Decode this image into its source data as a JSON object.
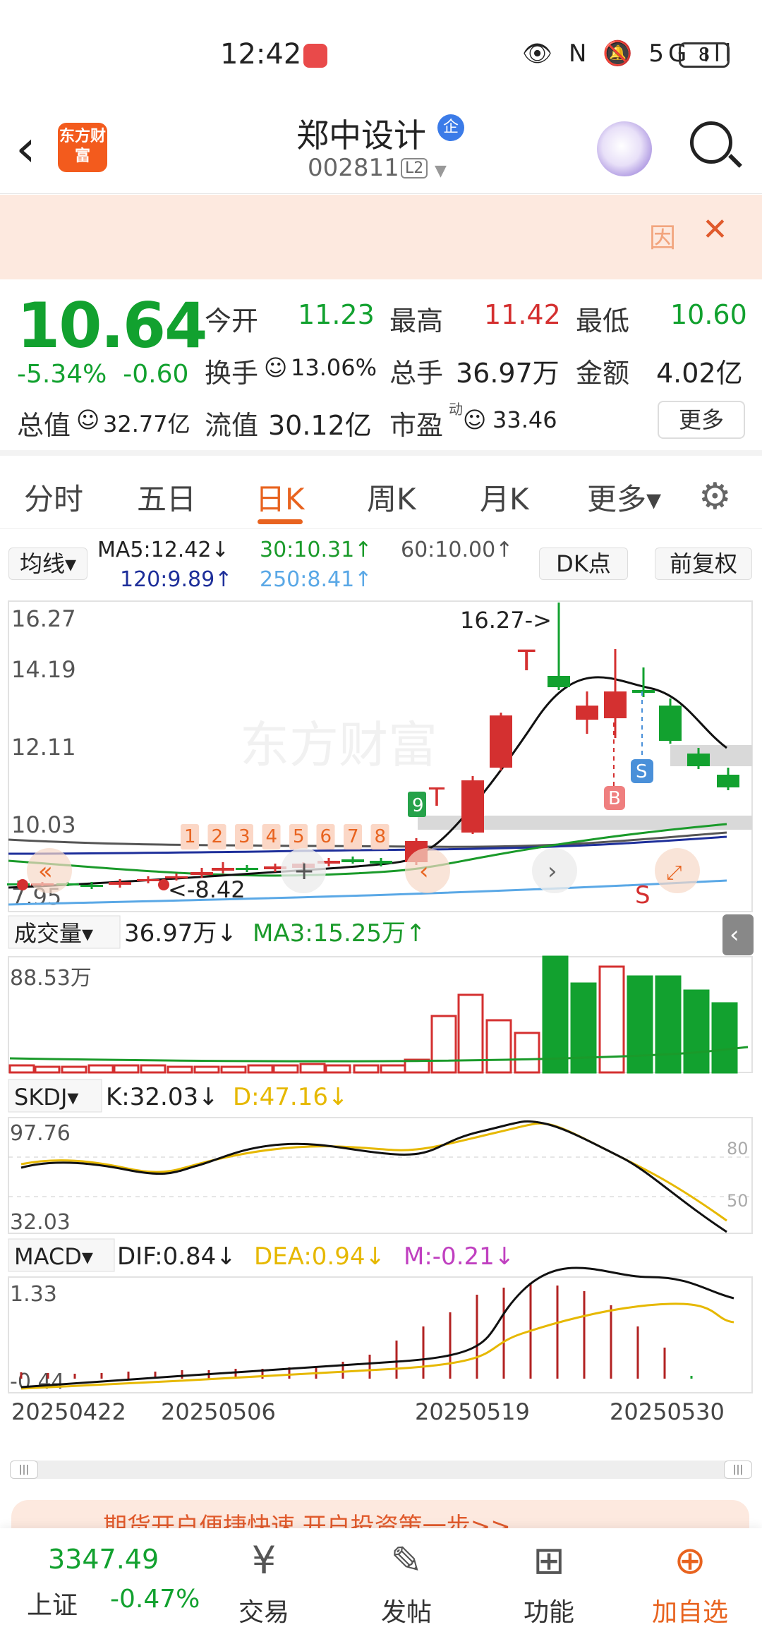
{
  "status": {
    "time": "12:42",
    "icons": "👁 N 🔕 5G ıll",
    "battery": "8"
  },
  "header": {
    "logo_text": "东方财富",
    "title": "郑中设计",
    "badge": "企",
    "code": "002811",
    "level": "L2"
  },
  "banner": {
    "text": "因",
    "close": "✕"
  },
  "quote": {
    "price": "10.64",
    "change_pct": "-5.34%",
    "change": "-0.60",
    "open_label": "今开",
    "open": "11.23",
    "high_label": "最高",
    "high": "11.42",
    "low_label": "最低",
    "low": "10.60",
    "turnover_label": "换手",
    "turnover": "13.06%",
    "volume_label": "总手",
    "volume": "36.97万",
    "amount_label": "金额",
    "amount": "4.02亿",
    "mktcap_label": "总值",
    "mktcap": "32.77亿",
    "float_label": "流值",
    "float": "30.12亿",
    "pe_label": "市盈",
    "pe_sup": "动",
    "pe": "33.46",
    "more": "更多"
  },
  "tabs": [
    {
      "label": "分时"
    },
    {
      "label": "五日"
    },
    {
      "label": "日K"
    },
    {
      "label": "周K"
    },
    {
      "label": "月K"
    },
    {
      "label": "更多▾"
    }
  ],
  "ma": {
    "selector": "均线▾",
    "ma5": "MA5:12.42↓",
    "ma30": "30:10.31↑",
    "ma60": "60:10.00↑",
    "ma120": "120:9.89↑",
    "ma250": "250:8.41↑",
    "dk": "DK点",
    "fq": "前复权"
  },
  "kchart": {
    "y_labels": [
      "16.27",
      "14.19",
      "12.11",
      "10.03",
      "7.95"
    ],
    "peak_label": "16.27->",
    "low_label": "<-8.42",
    "counts": [
      "1",
      "2",
      "3",
      "4",
      "5",
      "6",
      "7",
      "8"
    ],
    "nine": "9",
    "watermark": "东方财富"
  },
  "volume": {
    "selector": "成交量▾",
    "value": "36.97万↓",
    "ma3": "MA3:15.25万↑",
    "max_label": "88.53万"
  },
  "skdj": {
    "selector": "SKDJ▾",
    "k": "K:32.03↓",
    "d": "D:47.16↓",
    "top": "97.76",
    "bottom": "32.03",
    "l80": "80",
    "l50": "50"
  },
  "macd": {
    "selector": "MACD▾",
    "dif": "DIF:0.84↓",
    "dea": "DEA:0.94↓",
    "m": "M:-0.21↓",
    "top": "1.33",
    "bottom": "-0.44"
  },
  "dates": [
    "20250422",
    "20250506",
    "20250519",
    "20250530"
  ],
  "ad": {
    "text": "期货开户便捷快速 开户投资策一步>>"
  },
  "bottom": {
    "index_value": "3347.49",
    "index_name": "上证",
    "index_change": "-0.47%",
    "nav": [
      {
        "label": "交易"
      },
      {
        "label": "发帖"
      },
      {
        "label": "功能"
      },
      {
        "label": "加自选"
      }
    ]
  },
  "colors": {
    "up": "#d43030",
    "down": "#12a12f",
    "accent": "#e8631f"
  }
}
